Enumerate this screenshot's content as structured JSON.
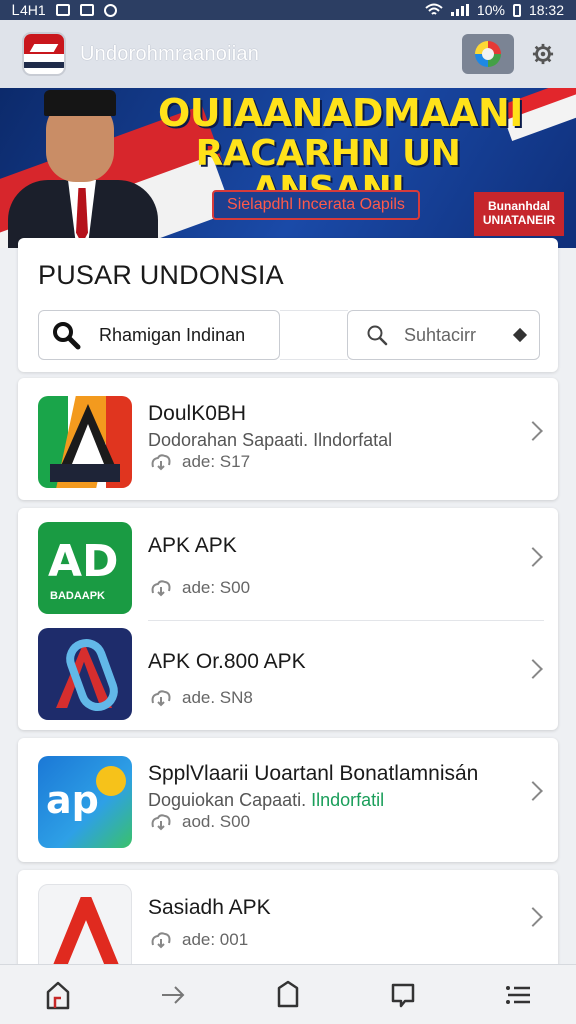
{
  "status_bar": {
    "left_text": "Ꮮ4Н1",
    "battery": "10%",
    "time": "18:32"
  },
  "app": {
    "title": "Undorohmraanoiian"
  },
  "banner": {
    "headline_1": "OUIAANADMAANI",
    "headline_2": "RACARHN UN ANSANI",
    "subtitle": "Sielapdhl Incerata Oapils",
    "badge": "Bunanhdal UNIATANEIR"
  },
  "search": {
    "title": "PUSAR UNDONSIA",
    "input_value": "Rhamigan Indinan",
    "sort_value": "Suhtacirr"
  },
  "apps": [
    {
      "name": "DoulK0BH",
      "desc": "Dodorahan Sapaati. Ilndorfatal",
      "desc_hl": "",
      "meta": "ade: S17"
    },
    {
      "name": "APK  APK",
      "desc": "",
      "desc_hl": "",
      "meta": "ade: S00",
      "thumb_big": "AD",
      "thumb_small": "BADAAPK"
    },
    {
      "name": "APK Or.800 APK",
      "desc": "",
      "desc_hl": "",
      "meta": "ade. SN8"
    },
    {
      "name": "SpplVlaarii Uoartanl Bonatlamnisán",
      "desc": "Doguiokan Capaati.",
      "desc_hl": "Ilndorfatil",
      "meta": "aod. S00",
      "thumb_text": "ap"
    },
    {
      "name": "Sasiadh APK",
      "desc": "",
      "desc_hl": "",
      "meta": "ade: 001"
    }
  ],
  "colors": {
    "status_bar": "#2c3e63",
    "header": "#dfe3ea",
    "banner_bg": "#1a4aa8",
    "headline": "#ffe21a",
    "accent_green": "#1a9e5a"
  }
}
